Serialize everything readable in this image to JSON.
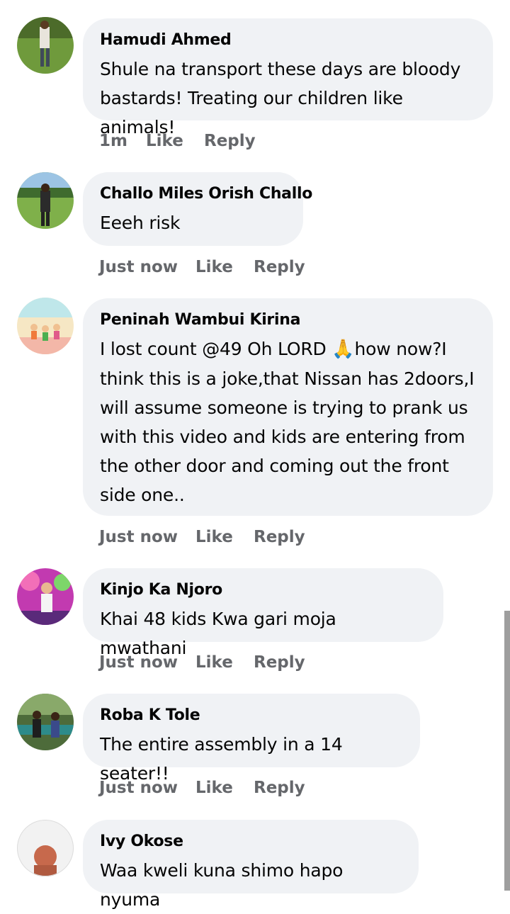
{
  "comments": [
    {
      "author": "Hamudi Ahmed",
      "text": "Shule na transport these days are bloody bastards! Treating our children like animals!",
      "time": "1m",
      "like_label": "Like",
      "reply_label": "Reply"
    },
    {
      "author": "Challo Miles Orish Challo",
      "text": "Eeeh risk",
      "time": "Just now",
      "like_label": "Like",
      "reply_label": "Reply"
    },
    {
      "author": "Peninah Wambui Kirina",
      "text_before_emoji": "I lost count @49 Oh LORD ",
      "emoji": "🙏",
      "text_after_emoji": "how now?I think this is a joke,that Nissan has 2doors,I will assume someone is trying to prank us with this video and kids are entering from the other door and coming out the front side one..",
      "time": "Just now",
      "like_label": "Like",
      "reply_label": "Reply"
    },
    {
      "author": "Kinjo Ka Njoro",
      "text": "Khai 48 kids Kwa gari moja mwathani",
      "time": "Just now",
      "like_label": "Like",
      "reply_label": "Reply"
    },
    {
      "author": "Roba K Tole",
      "text": "The entire assembly in a 14 seater!!",
      "time": "Just now",
      "like_label": "Like",
      "reply_label": "Reply"
    },
    {
      "author": "Ivy Okose",
      "text": "Waa kweli kuna shimo hapo nyuma"
    }
  ]
}
